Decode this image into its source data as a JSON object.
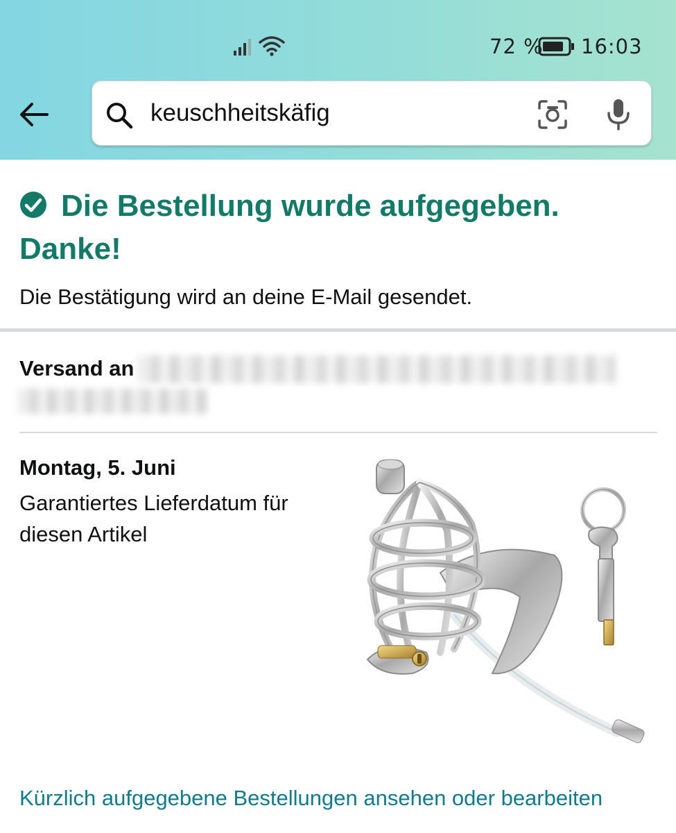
{
  "status_bar": {
    "battery_percent": "72 %",
    "time": "16:03"
  },
  "search": {
    "query": "keuschheitskäfig"
  },
  "confirmation": {
    "title": "Die Bestellung wurde aufgegeben. Danke!",
    "subtitle": "Die Bestätigung wird an deine E-Mail gesendet."
  },
  "shipping": {
    "label": "Versand an"
  },
  "delivery": {
    "date": "Montag, 5. Juni",
    "note": "Garantiertes Lieferdatum für diesen Artikel"
  },
  "footer": {
    "orders_link": "Kürzlich aufgegebene Bestellungen ansehen oder bearbeiten"
  },
  "colors": {
    "accent_green": "#127a67",
    "link_teal": "#127a8a",
    "header_gradient_start": "#83d6e2",
    "header_gradient_end": "#a6e3cf"
  },
  "icons": [
    "signal-icon",
    "wifi-icon",
    "battery-icon",
    "back-arrow-icon",
    "search-icon",
    "camera-icon",
    "microphone-icon",
    "check-circle-icon"
  ]
}
